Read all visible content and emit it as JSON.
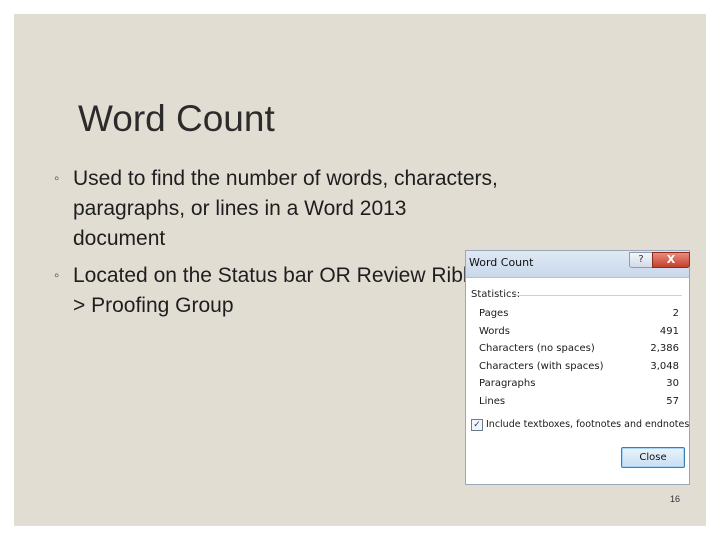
{
  "slide": {
    "title": "Word Count",
    "bullets": [
      "Used to find the number of words, characters, paragraphs, or lines in a Word 2013 document",
      "Located on the Status bar OR Review Ribbon > Proofing Group"
    ],
    "bullet_mark": "◦",
    "slide_number": "16"
  },
  "dialog": {
    "title": "Word Count",
    "help_label": "?",
    "close_x_label": "X",
    "statistics_label": "Statistics:",
    "stats": [
      {
        "name": "Pages",
        "value": "2"
      },
      {
        "name": "Words",
        "value": "491"
      },
      {
        "name": "Characters (no spaces)",
        "value": "2,386"
      },
      {
        "name": "Characters (with spaces)",
        "value": "3,048"
      },
      {
        "name": "Paragraphs",
        "value": "30"
      },
      {
        "name": "Lines",
        "value": "57"
      }
    ],
    "include_checkbox": {
      "label": "Include textboxes, footnotes and endnotes",
      "checked": true
    },
    "close_button": "Close"
  }
}
